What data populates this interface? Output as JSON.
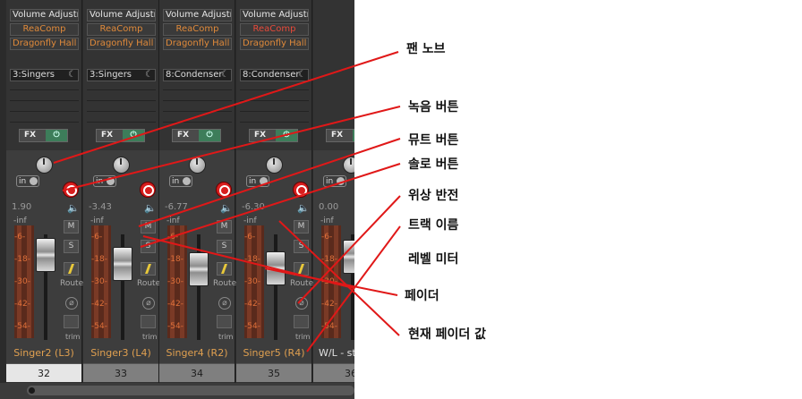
{
  "strips": [
    {
      "fx1": "Volume Adjustr",
      "fx2": "ReaComp",
      "fx2_color": "orange",
      "fx3": "Dragonfly Hall R",
      "input": "3:Singers",
      "fx_label": "FX",
      "in_label": "in",
      "vol": "1.90",
      "inf": "-inf",
      "mute": "M",
      "solo": "S",
      "route": "Route",
      "phase": "⌀",
      "trim": "trim",
      "name": "Singer2 (L3)",
      "number": "32",
      "selected": true
    },
    {
      "fx1": "Volume Adjustr",
      "fx2": "ReaComp",
      "fx2_color": "orange",
      "fx3": "Dragonfly Hall R",
      "input": "3:Singers",
      "fx_label": "FX",
      "in_label": "in",
      "vol": "-3.43",
      "inf": "-inf",
      "mute": "M",
      "solo": "S",
      "route": "Route",
      "phase": "⌀",
      "trim": "trim",
      "name": "Singer3 (L4)",
      "number": "33",
      "selected": false
    },
    {
      "fx1": "Volume Adjustr",
      "fx2": "ReaComp",
      "fx2_color": "orange",
      "fx3": "Dragonfly Hall R",
      "input": "8:Condenser",
      "fx_label": "FX",
      "in_label": "in",
      "vol": "-6.77",
      "inf": "-inf",
      "mute": "M",
      "solo": "S",
      "route": "Route",
      "phase": "⌀",
      "trim": "trim",
      "name": "Singer4 (R2)",
      "number": "34",
      "selected": false
    },
    {
      "fx1": "Volume Adjustr",
      "fx2": "ReaComp",
      "fx2_color": "red",
      "fx3": "Dragonfly Hall R",
      "input": "8:Condenser",
      "fx_label": "FX",
      "in_label": "in",
      "vol": "-6.30",
      "inf": "-inf",
      "mute": "M",
      "solo": "S",
      "route": "Route",
      "phase": "⌀",
      "trim": "trim",
      "name": "Singer5 (R4)",
      "number": "35",
      "selected": false
    },
    {
      "fx_label": "FX",
      "in_label": "in",
      "vol": "0.00",
      "inf": "-inf",
      "name": "W/L - st",
      "number": "36"
    }
  ],
  "meter_ticks": [
    "-6-",
    "-18-",
    "-30-",
    "-42-",
    "-54-"
  ],
  "fader_levels_db": [
    1.9,
    -3.43,
    -6.77,
    -6.3,
    0.0
  ],
  "callouts": {
    "pan": "팬 노브",
    "record": "녹음 버튼",
    "mute": "뮤트 버튼",
    "solo": "솔로 버튼",
    "phase": "위상 반전",
    "track_name": "트랙 이름",
    "level_meter": "레벨 미터",
    "fader": "페이더",
    "fader_value": "현재 페이더 값"
  },
  "colors": {
    "annotation_line": "#e01818",
    "track_name": "#e0a050",
    "record": "#d81e1e",
    "fx_power": "#3d7d5a"
  }
}
